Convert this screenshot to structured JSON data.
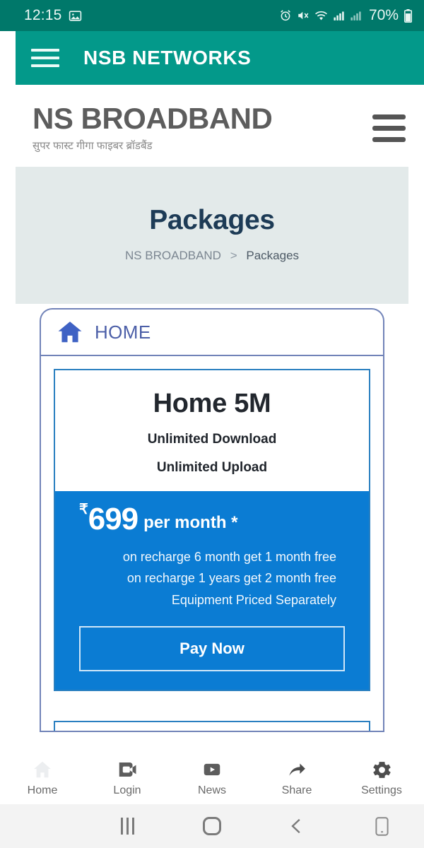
{
  "status_bar": {
    "time": "12:15",
    "battery_text": "70%",
    "icons": [
      "image-icon",
      "alarm-icon",
      "mute-icon",
      "wifi-icon",
      "signal-icon",
      "signal-2-icon",
      "battery-icon"
    ],
    "bg_color": "#00786a"
  },
  "app_bar": {
    "title": "NSB NETWORKS",
    "menu_icon": "hamburger-menu-icon",
    "bg_color": "#03998a"
  },
  "site_header": {
    "brand": "NS BROADBAND",
    "tagline": "सुपर फास्ट गीगा फाइबर ब्रॉडबैंड",
    "menu_icon": "hamburger-menu-icon"
  },
  "page_band": {
    "title": "Packages",
    "breadcrumb": {
      "root": "NS BROADBAND",
      "separator": ">",
      "current": "Packages"
    }
  },
  "panel": {
    "tab": {
      "icon": "home-icon",
      "label": "HOME"
    },
    "accent_color": "#0b7cd3",
    "border_color": "#7183b8"
  },
  "package": {
    "name": "Home 5M",
    "features": [
      "Unlimited Download",
      "Unlimited Upload"
    ],
    "currency": "₹",
    "price": "699",
    "price_period": "per month *",
    "offers": [
      "on recharge 6 month get 1 month free",
      "on recharge 1 years get 2 month free",
      "Equipment Priced Separately"
    ],
    "cta_label": "Pay Now"
  },
  "bottom_nav": {
    "items": [
      {
        "label": "Home",
        "icon": "home-icon",
        "active": true
      },
      {
        "label": "Login",
        "icon": "video-camera-icon",
        "active": false
      },
      {
        "label": "News",
        "icon": "play-button-icon",
        "active": false
      },
      {
        "label": "Share",
        "icon": "share-arrow-icon",
        "active": false
      },
      {
        "label": "Settings",
        "icon": "gear-icon",
        "active": false
      }
    ]
  },
  "system_nav": {
    "recents_icon": "recents-icon",
    "home_icon": "home-square-icon",
    "back_icon": "back-chevron-icon",
    "device_icon": "device-icon"
  }
}
